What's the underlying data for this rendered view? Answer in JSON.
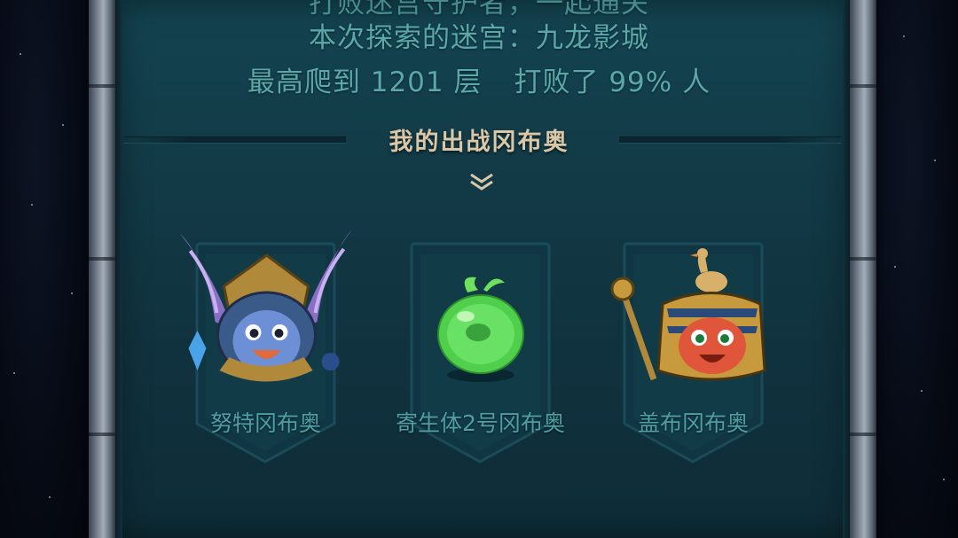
{
  "result": {
    "top_line_partial": "打败迷宫守护者，一起通关",
    "maze_line": "本次探索的迷宫：九龙影城",
    "stats": {
      "floor_text": "最高爬到 1201 层",
      "beat_text": "打败了 99% 人"
    }
  },
  "section": {
    "title": "我的出战冈布奥"
  },
  "cards": [
    {
      "name": "努特冈布奥",
      "icon": "winged-pharaoh-warrior-icon"
    },
    {
      "name": "寄生体2号冈布奥",
      "icon": "green-slime-icon"
    },
    {
      "name": "盖布冈布奥",
      "icon": "pharaoh-with-goose-icon"
    }
  ],
  "colors": {
    "panel": "#123b47",
    "info_text": "#5aa8a9",
    "title_text": "#d9c7a8",
    "card_name": "#4f9ea3"
  }
}
